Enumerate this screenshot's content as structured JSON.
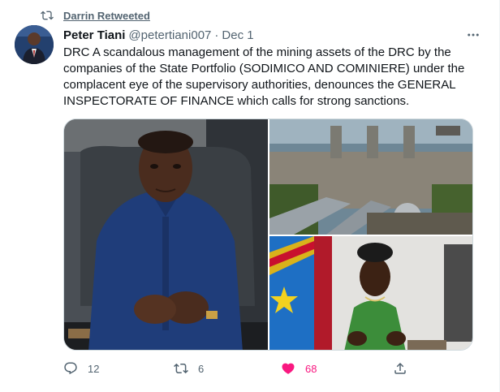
{
  "retweet": {
    "label": "Darrin Retweeted"
  },
  "tweet": {
    "author_name": "Peter Tiani",
    "handle": "@petertiani007",
    "separator": "·",
    "date": "Dec 1",
    "text": "DRC A scandalous management of the mining assets of the DRC by the companies of the State Portfolio (SODIMICO AND COMINIERE) under the complacent eye of the supervisory authorities, denounces the GENERAL INSPECTORATE OF FINANCE which calls for strong sanctions."
  },
  "actions": {
    "replies": "12",
    "retweets": "6",
    "likes": "68"
  },
  "colors": {
    "text": "#0f1419",
    "secondary": "#536471",
    "like": "#f91880",
    "border": "#cfd9de"
  },
  "icons": [
    "retweet-icon",
    "more-icon",
    "reply-icon",
    "like-icon-filled",
    "share-icon"
  ]
}
